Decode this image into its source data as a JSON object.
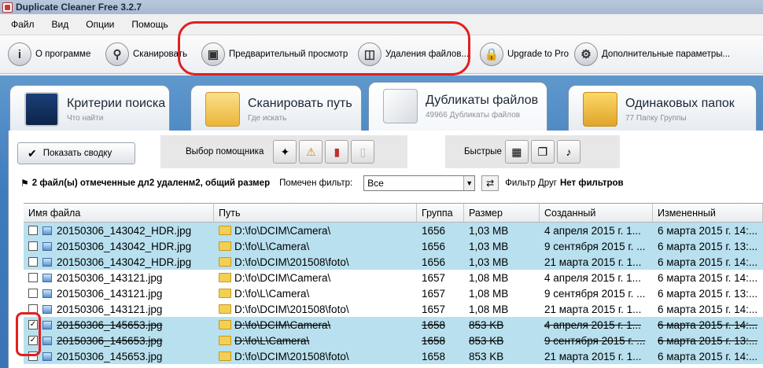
{
  "window": {
    "title": "Duplicate Cleaner Free 3.2.7"
  },
  "menu": [
    "Файл",
    "Вид",
    "Опции",
    "Помощь"
  ],
  "toolbar": [
    {
      "label": "О программе",
      "icon": "info-icon"
    },
    {
      "label": "Сканировать",
      "icon": "magnifier-icon"
    },
    {
      "label": "Предварительный просмотр",
      "icon": "preview-icon"
    },
    {
      "label": "Удаления файлов...",
      "icon": "trash-icon"
    },
    {
      "label": "Upgrade to Pro",
      "icon": "lock-icon"
    },
    {
      "label": "Дополнительные параметры...",
      "icon": "gear-icon"
    }
  ],
  "tabs": [
    {
      "label": "Критерии поиска",
      "sub": "Что найти",
      "icon": "monitor-icon"
    },
    {
      "label": "Сканировать путь",
      "sub": "Где искать",
      "icon": "folder-search-icon"
    },
    {
      "label": "Дубликаты файлов",
      "sub": "49966 Дубликаты файлов",
      "icon": "duplicate-files-icon"
    },
    {
      "label": "Одинаковых папок",
      "sub": "77 Папку Группы",
      "icon": "folders-icon"
    }
  ],
  "summary_button": "Показать сводку",
  "helper": {
    "label": "Выбор помощника"
  },
  "quick": {
    "label": "Быстрые"
  },
  "info": {
    "selected_text": "2 файл(ы) отмеченные дл2 удаленм2, общий размер",
    "filter_label": "Помечен фильтр:",
    "filter_value": "Все",
    "filter_friend_label": "Фильтр Друг",
    "filter_friend_value": "Нет фильтров"
  },
  "columns": [
    "Имя файла",
    "Путь",
    "Группа",
    "Размер",
    "Созданный",
    "Измененный"
  ],
  "rows": [
    {
      "checked": false,
      "strike": false,
      "name": "20150306_143042_HDR.jpg",
      "path": "D:\\fo\\DCIM\\Camera\\",
      "group": "1656",
      "size": "1,03 MB",
      "created": "4 апреля 2015 г. 1...",
      "modified": "6 марта 2015 г. 14:..."
    },
    {
      "checked": false,
      "strike": false,
      "name": "20150306_143042_HDR.jpg",
      "path": "D:\\fo\\L\\Camera\\",
      "group": "1656",
      "size": "1,03 MB",
      "created": "9 сентября 2015 г. ...",
      "modified": "6 марта 2015 г. 13:..."
    },
    {
      "checked": false,
      "strike": false,
      "name": "20150306_143042_HDR.jpg",
      "path": "D:\\fo\\DCIM\\201508\\foto\\",
      "group": "1656",
      "size": "1,03 MB",
      "created": "21 марта 2015 г. 1...",
      "modified": "6 марта 2015 г. 14:..."
    },
    {
      "checked": false,
      "strike": false,
      "name": "20150306_143121.jpg",
      "path": "D:\\fo\\DCIM\\Camera\\",
      "group": "1657",
      "size": "1,08 MB",
      "created": "4 апреля 2015 г. 1...",
      "modified": "6 марта 2015 г. 14:..."
    },
    {
      "checked": false,
      "strike": false,
      "name": "20150306_143121.jpg",
      "path": "D:\\fo\\L\\Camera\\",
      "group": "1657",
      "size": "1,08 MB",
      "created": "9 сентября 2015 г. ...",
      "modified": "6 марта 2015 г. 13:..."
    },
    {
      "checked": false,
      "strike": false,
      "name": "20150306_143121.jpg",
      "path": "D:\\fo\\DCIM\\201508\\foto\\",
      "group": "1657",
      "size": "1,08 MB",
      "created": "21 марта 2015 г. 1...",
      "modified": "6 марта 2015 г. 14:..."
    },
    {
      "checked": true,
      "strike": true,
      "name": "20150306_145653.jpg",
      "path": "D:\\fo\\DCIM\\Camera\\",
      "group": "1658",
      "size": "853 KB",
      "created": "4 апреля 2015 г. 1...",
      "modified": "6 марта 2015 г. 14:..."
    },
    {
      "checked": true,
      "strike": true,
      "name": "20150306_145653.jpg",
      "path": "D:\\fo\\L\\Camera\\",
      "group": "1658",
      "size": "853 KB",
      "created": "9 сентября 2015 г. ...",
      "modified": "6 марта 2015 г. 13:..."
    },
    {
      "checked": false,
      "strike": false,
      "name": "20150306_145653.jpg",
      "path": "D:\\fo\\DCIM\\201508\\foto\\",
      "group": "1658",
      "size": "853 KB",
      "created": "21 марта 2015 г. 1...",
      "modified": "6 марта 2015 г. 14:..."
    }
  ],
  "colors": {
    "group_highlight": "#b9e0ee",
    "annotation_red": "#e02020",
    "tab_band": "#3f7cbd"
  }
}
